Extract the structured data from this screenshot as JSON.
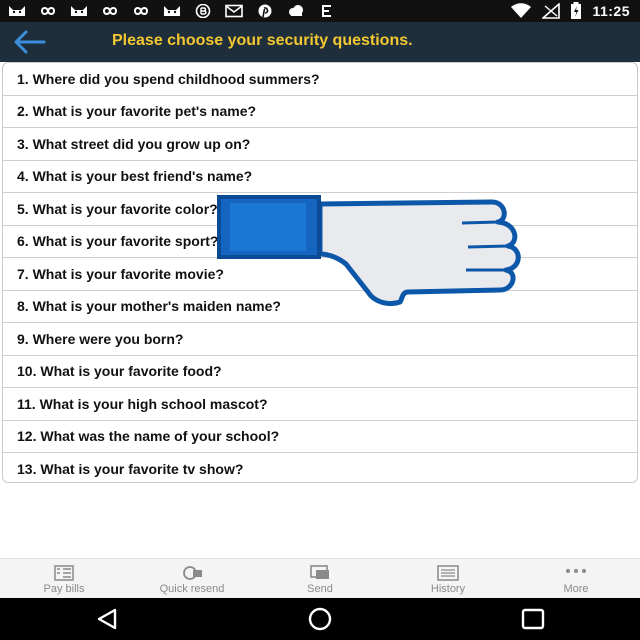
{
  "status_bar": {
    "time": "11:25",
    "left_icons": [
      "cat-emoji-icon",
      "infinity-icon",
      "cat-emoji-icon",
      "infinity-icon",
      "infinity-icon",
      "cat-emoji-icon",
      "bitcoin-icon",
      "mail-icon",
      "pinterest-icon",
      "cloud-icon",
      "e-icon"
    ],
    "right_icons": [
      "wifi-icon",
      "signal-off-icon",
      "battery-charging-icon"
    ]
  },
  "header": {
    "title": "Please choose your security questions.",
    "back_icon": "arrow-left-icon",
    "title_color": "#f3c731",
    "background": "#1e2f3b"
  },
  "questions": [
    "1. Where did you spend childhood summers?",
    "2. What is your favorite pet's name?",
    "3. What street did you grow up on?",
    "4. What is your best friend's name?",
    "5. What is your favorite color?",
    "6. What is your favorite sport?",
    "7. What is your favorite movie?",
    "8. What is your mother's maiden name?",
    "9. Where were you born?",
    "10. What is your favorite food?",
    "11. What is your high school mascot?",
    "12. What was the name of your school?",
    "13. What is your favorite tv show?"
  ],
  "overlay": {
    "icon": "thumbs-down-icon",
    "cuff_color": "#1565c0",
    "hand_color": "#e8eaee"
  },
  "bottom_nav": [
    {
      "label": "Pay bills",
      "icon": "bill-icon"
    },
    {
      "label": "Quick resend",
      "icon": "quick-resend-icon"
    },
    {
      "label": "Send",
      "icon": "send-money-icon"
    },
    {
      "label": "History",
      "icon": "history-icon"
    },
    {
      "label": "More",
      "icon": "more-dots-icon"
    }
  ],
  "system_nav": {
    "buttons": [
      "back-triangle-icon",
      "home-circle-icon",
      "recents-square-icon"
    ]
  }
}
